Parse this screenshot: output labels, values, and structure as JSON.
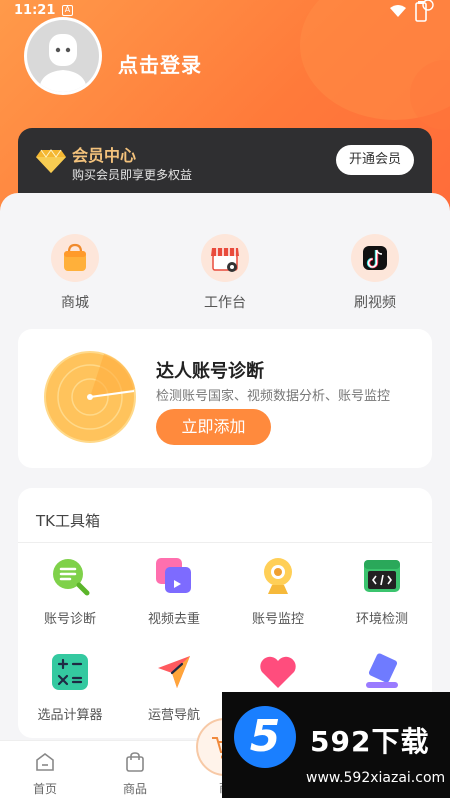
{
  "status_bar": {
    "time": "11:21",
    "notif_letter": "A"
  },
  "profile": {
    "login_label": "点击登录"
  },
  "vip": {
    "title": "会员中心",
    "subtitle": "购买会员即享更多权益",
    "button": "开通会员"
  },
  "quick_links": [
    {
      "label": "商城",
      "icon": "shopping-bag-icon"
    },
    {
      "label": "工作台",
      "icon": "storefront-gear-icon"
    },
    {
      "label": "刷视频",
      "icon": "tiktok-icon"
    }
  ],
  "diagnosis": {
    "title": "达人账号诊断",
    "description": "检测账号国家、视频数据分析、账号监控",
    "button": "立即添加"
  },
  "toolbox": {
    "title": "TK工具箱",
    "tools": [
      {
        "label": "账号诊断",
        "icon": "magnifier-list-icon"
      },
      {
        "label": "视频去重",
        "icon": "video-duplicate-icon"
      },
      {
        "label": "账号监控",
        "icon": "webcam-icon"
      },
      {
        "label": "环境检测",
        "icon": "code-window-icon"
      },
      {
        "label": "选品计算器",
        "icon": "calculator-icon"
      },
      {
        "label": "运营导航",
        "icon": "navigation-arrow-icon"
      },
      {
        "label": "",
        "icon": "heart-icon"
      },
      {
        "label": "",
        "icon": "eraser-icon"
      }
    ]
  },
  "tabbar": [
    {
      "label": "首页",
      "icon": "home-icon"
    },
    {
      "label": "商品",
      "icon": "bag-icon"
    },
    {
      "label": "商",
      "icon": "cart-icon"
    }
  ],
  "watermark": {
    "digit": "5",
    "brand": "592下载",
    "url": "www.592xiazai.com"
  },
  "colors": {
    "accent": "#ff8a3d",
    "vip_gold": "#f3c27c",
    "vip_bg": "#2f2f31"
  }
}
